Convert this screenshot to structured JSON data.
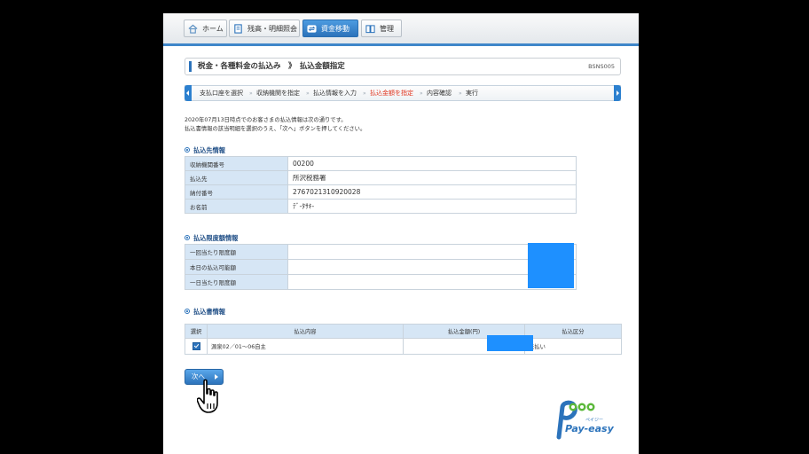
{
  "nav": {
    "tabs": [
      {
        "label": "ホーム",
        "icon": "home-icon",
        "active": false
      },
      {
        "label": "残高・明細照会",
        "icon": "document-icon",
        "active": false
      },
      {
        "label": "資金移動",
        "icon": "transfer-icon",
        "active": true
      },
      {
        "label": "管理",
        "icon": "book-icon",
        "active": false
      }
    ]
  },
  "title": {
    "text": "税金・各種料金の払込み　》　払込金額指定",
    "code": "BSNS005"
  },
  "steps": [
    {
      "label": "支払口座を選択"
    },
    {
      "label": "収納機関を指定"
    },
    {
      "label": "払込情報を入力"
    },
    {
      "label": "払込金額を指定",
      "current": true
    },
    {
      "label": "内容確認"
    },
    {
      "label": "実行"
    }
  ],
  "note": {
    "line1": "2020年07月13日時点でのお客さまの払込情報は次の通りです。",
    "line2": "払込書情報の該当明細を選択のうえ、「次へ」ボタンを押してください。"
  },
  "payee": {
    "heading": "払込先情報",
    "rows": [
      {
        "label": "収納機関番号",
        "value": "00200"
      },
      {
        "label": "払込先",
        "value": "所沢税務署"
      },
      {
        "label": "納付番号",
        "value": "2767021310920028"
      },
      {
        "label": "お名前",
        "value": "ﾃﾞ-ﾀｻｷ-"
      }
    ]
  },
  "limits": {
    "heading": "払込限度額情報",
    "rows": [
      {
        "label": "一回当たり限度額",
        "value": ""
      },
      {
        "label": "本日の払込可能額",
        "value": ""
      },
      {
        "label": "一日当たり限度額",
        "value": ""
      }
    ]
  },
  "bills": {
    "heading": "払込書情報",
    "headers": [
      "選択",
      "払込内容",
      "払込金額(円)",
      "払込区分"
    ],
    "rows": [
      {
        "selected": true,
        "content": "源泉02／01～06自主",
        "amount": "",
        "status": "未払い"
      }
    ]
  },
  "next_button": {
    "label": "次へ"
  },
  "logo": {
    "text": "Pay-easy",
    "kana": "ペイジー"
  },
  "colors": {
    "accent": "#2c73bb",
    "redaction": "#1e90ff",
    "current_step": "#e0341e"
  }
}
